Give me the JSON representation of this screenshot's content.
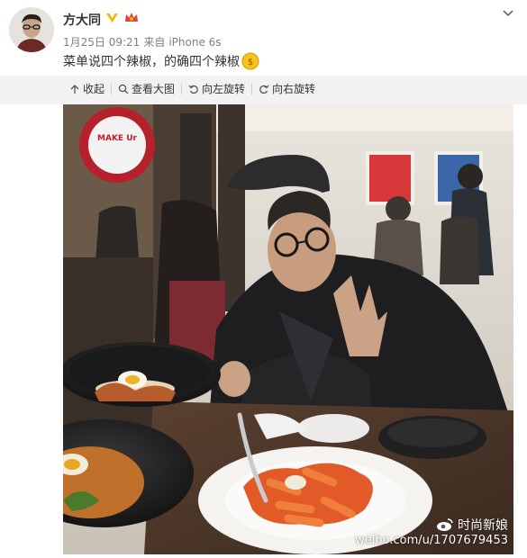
{
  "post": {
    "username": "方大同",
    "date": "1月25日 09:21",
    "source_prefix": "来自",
    "source": "iPhone 6s",
    "text": "菜单说四个辣椒，的确四个辣椒"
  },
  "toolbar": {
    "collapse": "收起",
    "view_large": "查看大图",
    "rotate_left": "向左旋转",
    "rotate_right": "向右旋转"
  },
  "photo": {
    "sign_text": "MAKE Ur",
    "watermark_name": "时尚新娘",
    "watermark_url": "weibo.com/u/1707679453"
  },
  "icons": {
    "verified": "verified-badge-icon",
    "level": "member-level-icon",
    "emoji": "money-face-emoji-icon",
    "chevron": "chevron-down-icon"
  },
  "colors": {
    "verified": "#f7b500",
    "toolbar_bg": "#f2f2f5",
    "meta_text": "#808080"
  }
}
